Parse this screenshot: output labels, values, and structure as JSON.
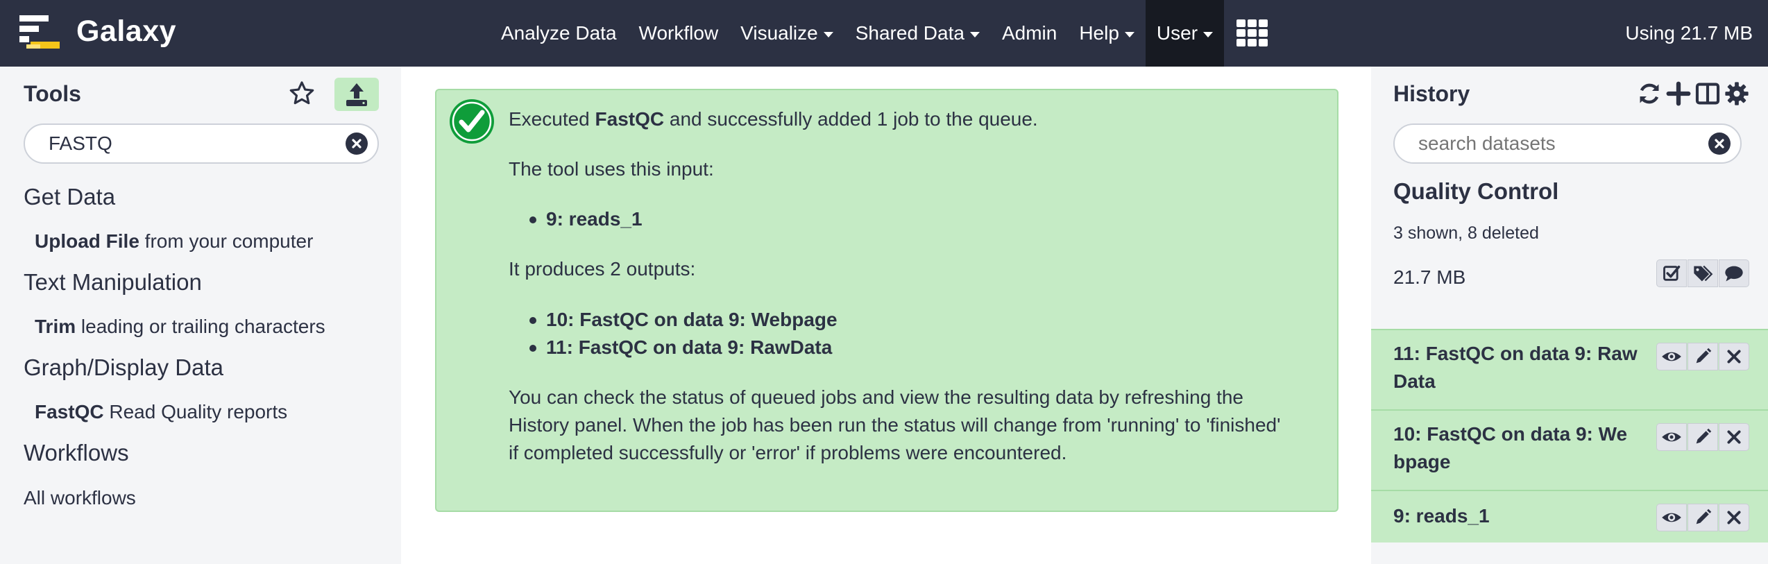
{
  "masthead": {
    "brand": "Galaxy",
    "nav": [
      {
        "label": "Analyze Data",
        "dropdown": false
      },
      {
        "label": "Workflow",
        "dropdown": false
      },
      {
        "label": "Visualize",
        "dropdown": true
      },
      {
        "label": "Shared Data",
        "dropdown": true
      },
      {
        "label": "Admin",
        "dropdown": false
      },
      {
        "label": "Help",
        "dropdown": true
      },
      {
        "label": "User",
        "dropdown": true,
        "active": true
      }
    ],
    "quota": "Using 21.7 MB"
  },
  "tool_panel": {
    "title": "Tools",
    "search_value": "FASTQ",
    "sections": [
      {
        "title": "Get Data",
        "tool_name": "Upload File",
        "tool_desc": " from your computer"
      },
      {
        "title": "Text Manipulation",
        "tool_name": "Trim",
        "tool_desc": " leading or trailing characters"
      },
      {
        "title": "Graph/Display Data",
        "tool_name": "FastQC",
        "tool_desc": " Read Quality reports"
      }
    ],
    "workflows_title": "Workflows",
    "all_workflows": "All workflows"
  },
  "message": {
    "prefix": "Executed ",
    "tool": "FastQC",
    "suffix": " and successfully added 1 job to the queue.",
    "input_intro": "The tool uses this input:",
    "inputs": [
      "9: reads_1"
    ],
    "output_intro": "It produces 2 outputs:",
    "outputs": [
      "10: FastQC on data 9: Webpage",
      "11: FastQC on data 9: RawData"
    ],
    "note_lines": [
      "You can check the status of queued jobs and view the resulting data by refreshing the",
      "History panel. When the job has been run the status will change from 'running' to 'finished'",
      "if completed successfully or 'error' if problems were encountered."
    ]
  },
  "history": {
    "title": "History",
    "search_placeholder": "search datasets",
    "name": "Quality Control",
    "counts": "3 shown, 8 deleted",
    "size": "21.7 MB",
    "datasets": [
      {
        "title": "11: FastQC on data 9: Raw Data",
        "state": "ok"
      },
      {
        "title": "10: FastQC on data 9: We bpage",
        "state": "ok"
      },
      {
        "title": "9: reads_1",
        "state": "ok"
      }
    ]
  },
  "colors": {
    "masthead": "#2c3143",
    "success_bg": "#c5ebc5",
    "success_border": "#a6dca6",
    "panel_bg": "#f4f5f7"
  }
}
